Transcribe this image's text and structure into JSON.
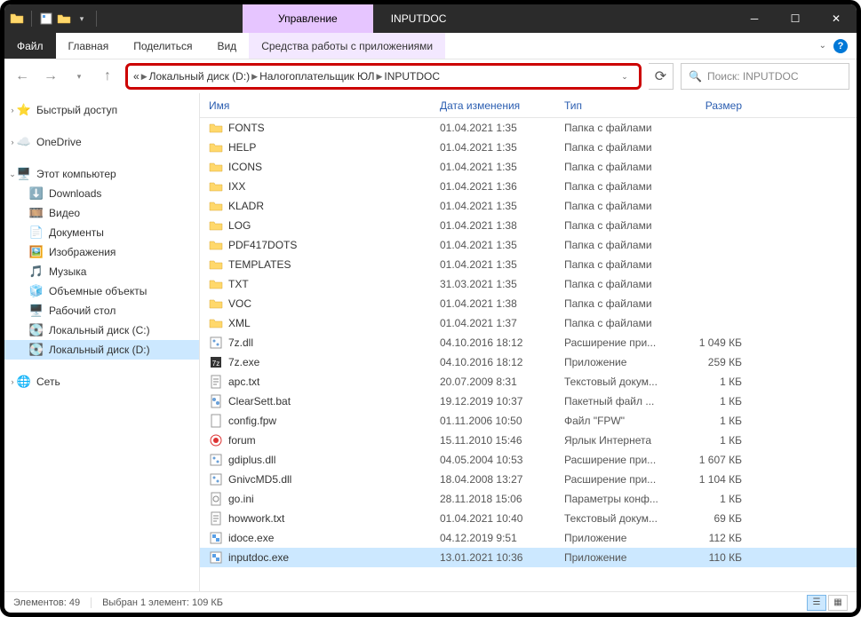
{
  "titlebar": {
    "context_tab": "Управление",
    "title": "INPUTDOC"
  },
  "ribbon": {
    "file": "Файл",
    "tabs": [
      "Главная",
      "Поделиться",
      "Вид"
    ],
    "context_tab": "Средства работы с приложениями"
  },
  "address": {
    "overflow": "«",
    "crumbs": [
      "Локальный диск (D:)",
      "Налогоплательщик ЮЛ",
      "INPUTDOC"
    ]
  },
  "search": {
    "placeholder": "Поиск: INPUTDOC"
  },
  "nav": {
    "quick": "Быстрый доступ",
    "onedrive": "OneDrive",
    "thispc": "Этот компьютер",
    "thispc_items": [
      "Downloads",
      "Видео",
      "Документы",
      "Изображения",
      "Музыка",
      "Объемные объекты",
      "Рабочий стол",
      "Локальный диск (C:)",
      "Локальный диск (D:)"
    ],
    "network": "Сеть"
  },
  "columns": {
    "name": "Имя",
    "date": "Дата изменения",
    "type": "Тип",
    "size": "Размер"
  },
  "files": [
    {
      "icon": "folder",
      "name": "FONTS",
      "date": "01.04.2021 1:35",
      "type": "Папка с файлами",
      "size": ""
    },
    {
      "icon": "folder",
      "name": "HELP",
      "date": "01.04.2021 1:35",
      "type": "Папка с файлами",
      "size": ""
    },
    {
      "icon": "folder",
      "name": "ICONS",
      "date": "01.04.2021 1:35",
      "type": "Папка с файлами",
      "size": ""
    },
    {
      "icon": "folder",
      "name": "IXX",
      "date": "01.04.2021 1:36",
      "type": "Папка с файлами",
      "size": ""
    },
    {
      "icon": "folder",
      "name": "KLADR",
      "date": "01.04.2021 1:35",
      "type": "Папка с файлами",
      "size": ""
    },
    {
      "icon": "folder",
      "name": "LOG",
      "date": "01.04.2021 1:38",
      "type": "Папка с файлами",
      "size": ""
    },
    {
      "icon": "folder",
      "name": "PDF417DOTS",
      "date": "01.04.2021 1:35",
      "type": "Папка с файлами",
      "size": ""
    },
    {
      "icon": "folder",
      "name": "TEMPLATES",
      "date": "01.04.2021 1:35",
      "type": "Папка с файлами",
      "size": ""
    },
    {
      "icon": "folder",
      "name": "TXT",
      "date": "31.03.2021 1:35",
      "type": "Папка с файлами",
      "size": ""
    },
    {
      "icon": "folder",
      "name": "VOC",
      "date": "01.04.2021 1:38",
      "type": "Папка с файлами",
      "size": ""
    },
    {
      "icon": "folder",
      "name": "XML",
      "date": "01.04.2021 1:37",
      "type": "Папка с файлами",
      "size": ""
    },
    {
      "icon": "dll",
      "name": "7z.dll",
      "date": "04.10.2016 18:12",
      "type": "Расширение при...",
      "size": "1 049 КБ"
    },
    {
      "icon": "exe7z",
      "name": "7z.exe",
      "date": "04.10.2016 18:12",
      "type": "Приложение",
      "size": "259 КБ"
    },
    {
      "icon": "txt",
      "name": "apc.txt",
      "date": "20.07.2009 8:31",
      "type": "Текстовый докум...",
      "size": "1 КБ"
    },
    {
      "icon": "bat",
      "name": "ClearSett.bat",
      "date": "19.12.2019 10:37",
      "type": "Пакетный файл ...",
      "size": "1 КБ"
    },
    {
      "icon": "file",
      "name": "config.fpw",
      "date": "01.11.2006 10:50",
      "type": "Файл \"FPW\"",
      "size": "1 КБ"
    },
    {
      "icon": "link",
      "name": "forum",
      "date": "15.11.2010 15:46",
      "type": "Ярлык Интернета",
      "size": "1 КБ"
    },
    {
      "icon": "dll",
      "name": "gdiplus.dll",
      "date": "04.05.2004 10:53",
      "type": "Расширение при...",
      "size": "1 607 КБ"
    },
    {
      "icon": "dll",
      "name": "GnivcMD5.dll",
      "date": "18.04.2008 13:27",
      "type": "Расширение при...",
      "size": "1 104 КБ"
    },
    {
      "icon": "ini",
      "name": "go.ini",
      "date": "28.11.2018 15:06",
      "type": "Параметры конф...",
      "size": "1 КБ"
    },
    {
      "icon": "txt",
      "name": "howwork.txt",
      "date": "01.04.2021 10:40",
      "type": "Текстовый докум...",
      "size": "69 КБ"
    },
    {
      "icon": "exe",
      "name": "idoce.exe",
      "date": "04.12.2019 9:51",
      "type": "Приложение",
      "size": "112 КБ"
    },
    {
      "icon": "exe",
      "name": "inputdoc.exe",
      "date": "13.01.2021 10:36",
      "type": "Приложение",
      "size": "110 КБ",
      "selected": true
    }
  ],
  "status": {
    "count": "Элементов: 49",
    "selection": "Выбран 1 элемент: 109 КБ"
  }
}
